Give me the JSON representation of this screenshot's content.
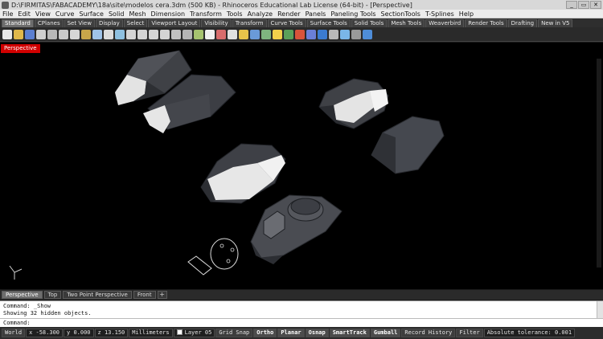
{
  "window": {
    "title": "D:\\FIRMITAS\\FABACADEMY\\18a\\site\\modelos cera.3dm (500 KB) - Rhinoceros Educational Lab License (64-bit) - [Perspective]",
    "buttons": [
      "_",
      "▭",
      "✕"
    ]
  },
  "menu": [
    "File",
    "Edit",
    "View",
    "Curve",
    "Surface",
    "Solid",
    "Mesh",
    "Dimension",
    "Transform",
    "Tools",
    "Analyze",
    "Render",
    "Panels",
    "Paneling Tools",
    "SectionTools",
    "T-Splines",
    "Help"
  ],
  "toolbar_tabs": [
    "Standard",
    "CPlanes",
    "Set View",
    "Display",
    "Select",
    "Viewport Layout",
    "Visibility",
    "Transform",
    "Curve Tools",
    "Surface Tools",
    "Solid Tools",
    "Mesh Tools",
    "Weaverbird",
    "Render Tools",
    "Drafting",
    "New in V5"
  ],
  "toolbar_icons": [
    {
      "name": "new-file-icon",
      "color": "#e8e8e8"
    },
    {
      "name": "open-file-icon",
      "color": "#e0b84a"
    },
    {
      "name": "save-icon",
      "color": "#5b7fd1"
    },
    {
      "name": "print-icon",
      "color": "#cfcfcf"
    },
    {
      "name": "properties-icon",
      "color": "#b8b8b8"
    },
    {
      "name": "cut-icon",
      "color": "#c9c9c9"
    },
    {
      "name": "copy-icon",
      "color": "#d7d7d7"
    },
    {
      "name": "paste-icon",
      "color": "#c8a64a"
    },
    {
      "name": "undo-icon",
      "color": "#9fc3e8"
    },
    {
      "name": "pan-icon",
      "color": "#dcdcdc"
    },
    {
      "name": "rotate-view-icon",
      "color": "#8ec0e0"
    },
    {
      "name": "zoom-icon",
      "color": "#d4d4d4"
    },
    {
      "name": "zoom-window-icon",
      "color": "#d4d4d4"
    },
    {
      "name": "zoom-extents-icon",
      "color": "#d4d4d4"
    },
    {
      "name": "zoom-selected-icon",
      "color": "#d4d4d4"
    },
    {
      "name": "undo-view-icon",
      "color": "#c2c2c2"
    },
    {
      "name": "four-view-icon",
      "color": "#b5b5b5"
    },
    {
      "name": "cplane-icon",
      "color": "#a6c36f"
    },
    {
      "name": "select-icon",
      "color": "#f0f0f0"
    },
    {
      "name": "hide-icon",
      "color": "#d86c6c"
    },
    {
      "name": "show-icon",
      "color": "#e0e0e0"
    },
    {
      "name": "lock-icon",
      "color": "#e7c34a"
    },
    {
      "name": "layer-icon",
      "color": "#6a9ad8"
    },
    {
      "name": "material-icon",
      "color": "#7fb57f"
    },
    {
      "name": "lights-icon",
      "color": "#f2d04b"
    },
    {
      "name": "render-icon",
      "color": "#5aa05a"
    },
    {
      "name": "color-wheel-icon",
      "color": "#d9533a"
    },
    {
      "name": "sphere-icon",
      "color": "#6a7fd8"
    },
    {
      "name": "globe-icon",
      "color": "#3b7bd1"
    },
    {
      "name": "gear-icon",
      "color": "#b9b9b9"
    },
    {
      "name": "shaded-icon",
      "color": "#7ab6e8"
    },
    {
      "name": "options-icon",
      "color": "#9a9a9a"
    },
    {
      "name": "help-icon",
      "color": "#4e8dd8"
    }
  ],
  "viewport": {
    "name": "Perspective",
    "accent": "#d10000"
  },
  "view_tabs": [
    "Perspective",
    "Top",
    "Two Point Perspective",
    "Front"
  ],
  "command_history": [
    "Command: _Show",
    "Showing 32 hidden objects."
  ],
  "command_prompt": "Command:",
  "status": {
    "cplane": "World",
    "x": "x -58.300",
    "y": "y 0.000",
    "z": "z 13.150",
    "units": "Millimeters",
    "layer": "Layer 05",
    "toggles": [
      "Grid Snap",
      "Ortho",
      "Planar",
      "Osnap",
      "SmartTrack",
      "Gumball",
      "Record History",
      "Filter"
    ],
    "tolerance": "Absolute tolerance: 0.001"
  }
}
